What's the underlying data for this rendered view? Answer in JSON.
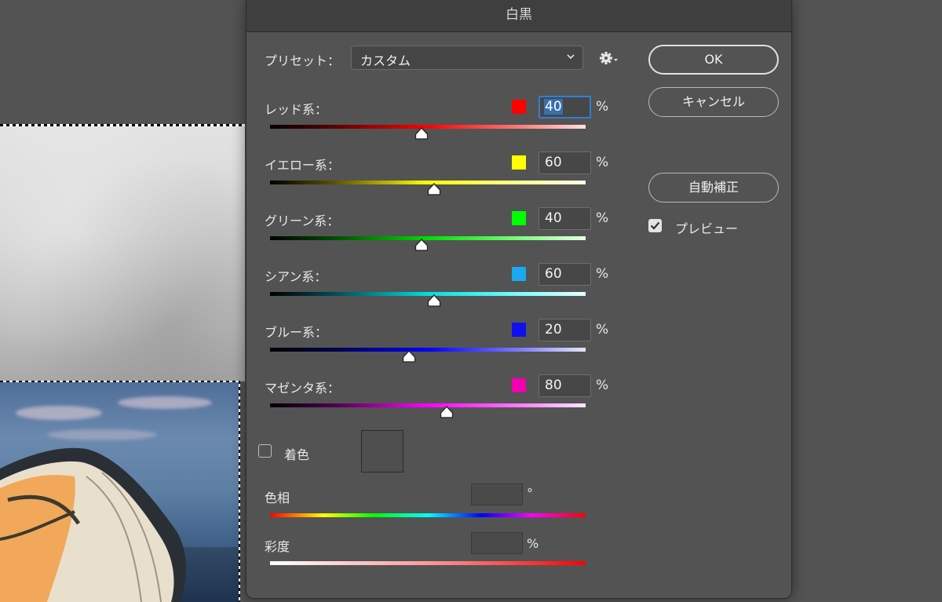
{
  "dialog": {
    "title": "白黒",
    "preset_label": "プリセット：",
    "preset_value": "カスタム",
    "sliders": [
      {
        "label": "レッド系：",
        "value": "40",
        "percent": 0.48,
        "swatch": "#ff0000"
      },
      {
        "label": "イエロー系：",
        "value": "60",
        "percent": 0.52,
        "swatch": "#ffff00"
      },
      {
        "label": "グリーン系：",
        "value": "40",
        "percent": 0.48,
        "swatch": "#00ff00"
      },
      {
        "label": "シアン系：",
        "value": "60",
        "percent": 0.52,
        "swatch": "#1aa8f0"
      },
      {
        "label": "ブルー系：",
        "value": "20",
        "percent": 0.44,
        "swatch": "#1010ee"
      },
      {
        "label": "マゼンタ系：",
        "value": "80",
        "percent": 0.56,
        "swatch": "#f000b0"
      }
    ],
    "percent_sign": "%",
    "tint_label": "着色",
    "tint_checked": false,
    "hue_label": "色相",
    "hue_unit": "°",
    "saturation_label": "彩度",
    "saturation_unit": "%"
  },
  "buttons": {
    "ok": "OK",
    "cancel": "キャンセル",
    "auto": "自動補正"
  },
  "preview": {
    "label": "プレビュー",
    "checked": true
  },
  "icons": {
    "preset_dropdown": "chevron-down-icon",
    "preset_options": "gear-icon",
    "preview_check": "check-icon",
    "slider_thumb": "triangle-thumb-icon"
  },
  "colors": {
    "dialog_bg": "#535353",
    "titlebar_bg": "#3f3f3f",
    "focus_ring": "#2f7fd6"
  }
}
